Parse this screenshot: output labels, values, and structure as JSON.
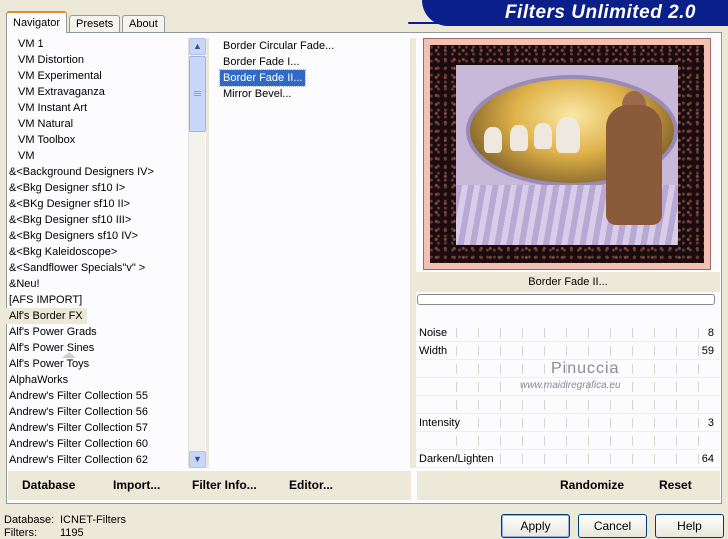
{
  "tabs": [
    {
      "label": "Navigator",
      "active": true
    },
    {
      "label": "Presets",
      "active": false
    },
    {
      "label": "About",
      "active": false
    }
  ],
  "brand": "Filters Unlimited 2.0",
  "categories": [
    "VM 1",
    "VM Distortion",
    "VM Experimental",
    "VM Extravaganza",
    "VM Instant Art",
    "VM Natural",
    "VM Toolbox",
    "VM",
    "&<Background Designers IV>",
    "&<Bkg Designer sf10 I>",
    "&<BKg Designer sf10 II>",
    "&<Bkg Designer sf10 III>",
    "&<Bkg Designers sf10 IV>",
    "&<Bkg Kaleidoscope>",
    "&<Sandflower Specials\"v\" >",
    "&Neu!",
    "[AFS IMPORT]",
    "Alf's Border FX",
    "Alf's Power Grads",
    "Alf's Power Sines",
    "Alf's Power Toys",
    "AlphaWorks",
    "Andrew's Filter Collection 55",
    "Andrew's Filter Collection 56",
    "Andrew's Filter Collection 57",
    "Andrew's Filter Collection 60",
    "Andrew's Filter Collection 62"
  ],
  "selected_category": "Alf's Border FX",
  "filters": [
    "Border Circular Fade...",
    "Border Fade I...",
    "Border Fade II...",
    "Mirror Bevel..."
  ],
  "selected_filter": "Border Fade II...",
  "preview": {
    "caption": "Border Fade II..."
  },
  "parameters": [
    {
      "label": "Noise",
      "value": "8"
    },
    {
      "label": "Width",
      "value": "59"
    },
    {
      "label": "",
      "value": ""
    },
    {
      "label": "",
      "value": ""
    },
    {
      "label": "",
      "value": ""
    },
    {
      "label": "Intensity",
      "value": "3"
    },
    {
      "label": "",
      "value": ""
    },
    {
      "label": "Darken/Lighten",
      "value": "64"
    }
  ],
  "watermark": {
    "line1": "Pinuccia",
    "line2": "www.maidiregrafica.eu"
  },
  "toolbar_left": [
    {
      "label": "Database",
      "key": "database"
    },
    {
      "label": "Import...",
      "key": "import"
    },
    {
      "label": "Filter Info...",
      "key": "filter-info"
    },
    {
      "label": "Editor...",
      "key": "editor"
    }
  ],
  "toolbar_right": [
    {
      "label": "Randomize",
      "key": "randomize"
    },
    {
      "label": "Reset",
      "key": "reset"
    }
  ],
  "footer": {
    "database_label": "Database:",
    "database_value": "ICNET-Filters",
    "filters_label": "Filters:",
    "filters_value": "1195"
  },
  "buttons": {
    "apply": "Apply",
    "cancel": "Cancel",
    "help": "Help"
  }
}
